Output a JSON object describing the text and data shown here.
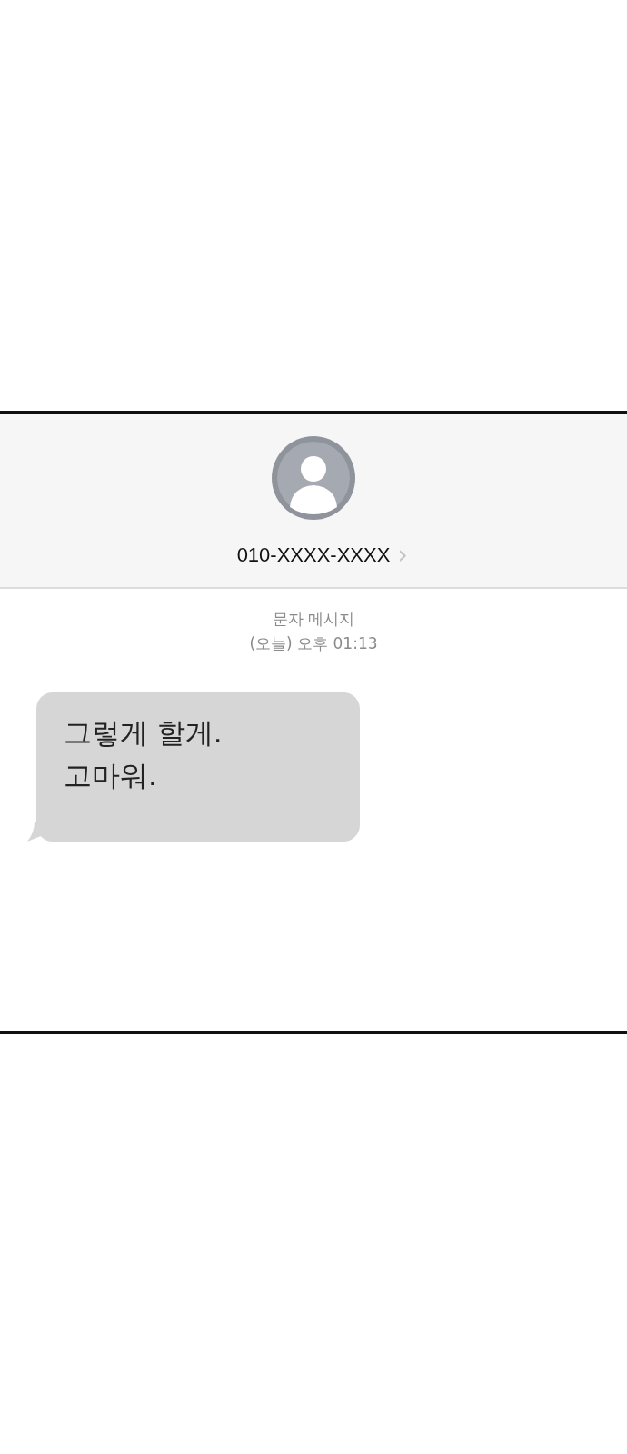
{
  "header": {
    "contact": "010-XXXX-XXXX",
    "chevron": "›"
  },
  "meta": {
    "type": "문자 메시지",
    "time": "(오늘) 오후 01:13"
  },
  "messages": [
    {
      "kind": "incoming",
      "lines": [
        "그렇게 할게.",
        "고마워."
      ]
    }
  ]
}
